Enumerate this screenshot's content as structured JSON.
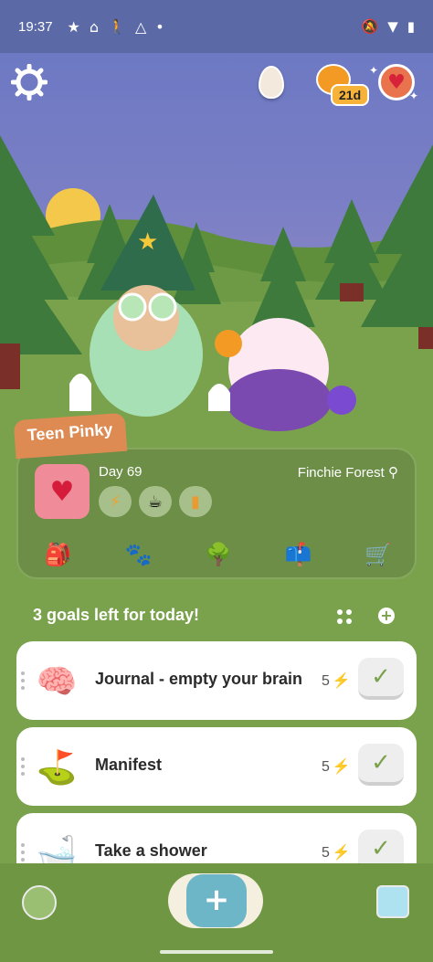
{
  "status_bar": {
    "time": "19:37",
    "dot": "•"
  },
  "header": {
    "streak": "21d"
  },
  "pet": {
    "name": "Teen Pinky",
    "day": "Day 69",
    "location": "Finchie Forest"
  },
  "goals_header": "3 goals left for today!",
  "goals": [
    {
      "title": "Journal - empty your brain",
      "energy": "5",
      "icon": "brain-icon"
    },
    {
      "title": "Manifest",
      "energy": "5",
      "icon": "flag-icon"
    },
    {
      "title": "Take a shower",
      "energy": "5",
      "icon": "bathtub-icon"
    }
  ],
  "colors": {
    "sky": "#6d79c3",
    "grass": "#7aa24c",
    "card": "#6c8e47",
    "accent_orange": "#de8b53",
    "plus_button": "#6db6c8"
  }
}
